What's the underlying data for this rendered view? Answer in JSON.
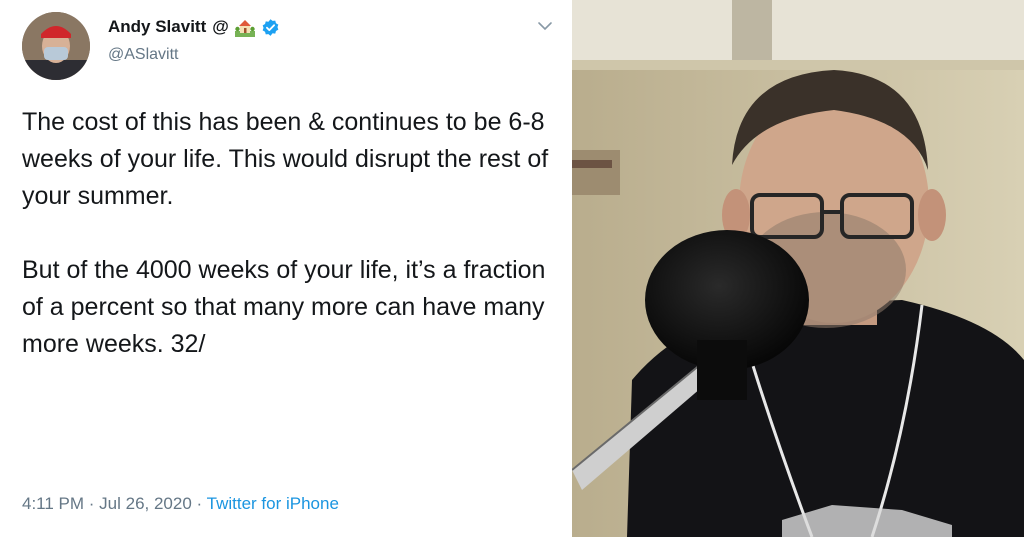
{
  "tweet": {
    "author_name": "Andy Slavitt",
    "author_suffix": "@",
    "handle": "@ASlavitt",
    "text": "The cost of this has been & continues to be 6-8 weeks of your life. This would disrupt the rest of your summer.\n\nBut of the 4000 weeks of your life, it’s a fraction of a percent so that many more can have many more weeks. 32/",
    "time": "4:11 PM",
    "separator": " · ",
    "date": "Jul 26, 2020",
    "source": "Twitter for iPhone"
  },
  "icons": {
    "house": "house-with-garden-icon",
    "verified": "verified-badge-icon",
    "chevron": "chevron-down-icon"
  },
  "colors": {
    "verified": "#1da1f2",
    "link": "#1b95e0",
    "secondary_text": "#657786",
    "primary_text": "#14171a"
  }
}
